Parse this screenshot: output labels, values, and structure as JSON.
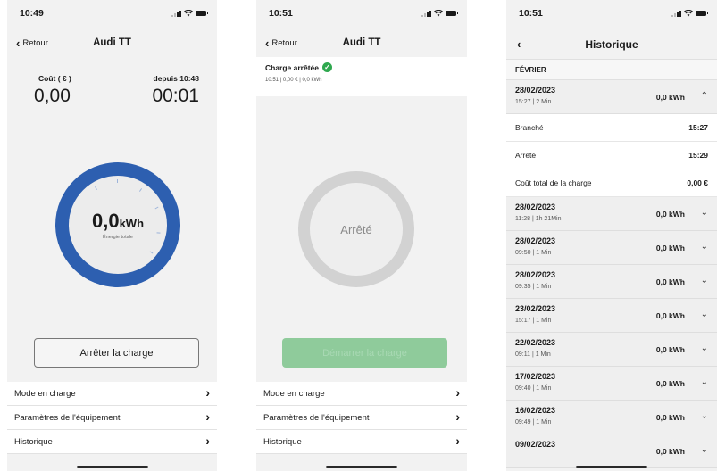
{
  "screen1": {
    "status_time": "10:49",
    "back_label": "Retour",
    "title": "Audi TT",
    "cost_label": "Coût ( € )",
    "cost_value": "0,00",
    "since_label": "depuis 10:48",
    "duration_value": "00:01",
    "energy_value": "0,0",
    "energy_unit": "kWh",
    "energy_label": "Énergie totale",
    "stop_button": "Arrêter la charge",
    "gauge_color": "#2d5fb0"
  },
  "screen2": {
    "status_time": "10:51",
    "back_label": "Retour",
    "title": "Audi TT",
    "charge_status": "Charge arrêtée",
    "charge_detail": "10:51 | 0,00 € | 0,0 kWh",
    "ring_label": "Arrêté",
    "start_button": "Démarrer la charge",
    "start_button_color": "#8fcb9b"
  },
  "menu": [
    {
      "label": "Mode en charge"
    },
    {
      "label": "Paramètres de l'équipement"
    },
    {
      "label": "Historique"
    }
  ],
  "screen3": {
    "status_time": "10:51",
    "title": "Historique",
    "month": "FÉVRIER",
    "expanded": {
      "date": "28/02/2023",
      "meta": "15:27 | 2 Min",
      "kwh": "0,0 kWh",
      "details": [
        {
          "label": "Branché",
          "value": "15:27"
        },
        {
          "label": "Arrêté",
          "value": "15:29"
        },
        {
          "label": "Coût total de la charge",
          "value": "0,00 €"
        }
      ]
    },
    "entries": [
      {
        "date": "28/02/2023",
        "meta": "11:28 | 1h 21Min",
        "kwh": "0,0 kWh"
      },
      {
        "date": "28/02/2023",
        "meta": "09:50 | 1 Min",
        "kwh": "0,0 kWh"
      },
      {
        "date": "28/02/2023",
        "meta": "09:35 | 1 Min",
        "kwh": "0,0 kWh"
      },
      {
        "date": "23/02/2023",
        "meta": "15:17 | 1 Min",
        "kwh": "0,0 kWh"
      },
      {
        "date": "22/02/2023",
        "meta": "09:11 | 1 Min",
        "kwh": "0,0 kWh"
      },
      {
        "date": "17/02/2023",
        "meta": "09:40 | 1 Min",
        "kwh": "0,0 kWh"
      },
      {
        "date": "16/02/2023",
        "meta": "09:49 | 1 Min",
        "kwh": "0,0 kWh"
      },
      {
        "date": "09/02/2023",
        "meta": "",
        "kwh": "0,0 kWh"
      }
    ]
  }
}
